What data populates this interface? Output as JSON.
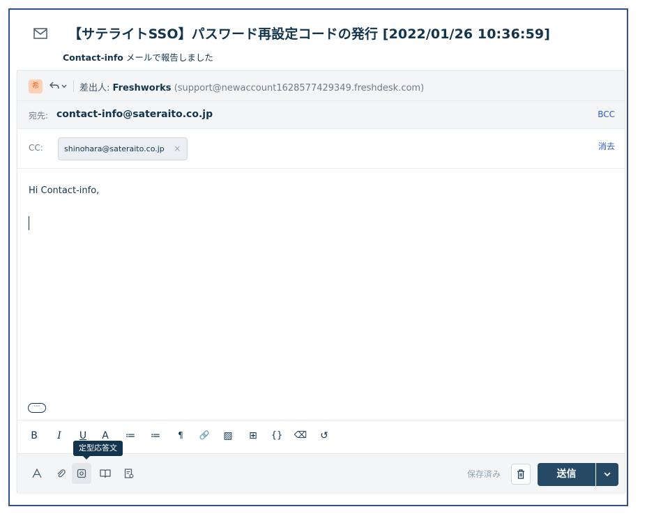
{
  "header": {
    "title": "【サテライトSSO】パスワード再設定コードの発行 [2022/01/26 10:36:59]",
    "subtitle_agent": "Contact-info",
    "subtitle_text": "メールで報告しました"
  },
  "from_row": {
    "avatar_text": "希",
    "label": "差出人:",
    "name": "Freshworks",
    "email": "(support@newaccount1628577429349.freshdesk.com)"
  },
  "to_row": {
    "label": "宛先:",
    "value": "contact-info@sateraito.co.jp",
    "bcc_label": "BCC"
  },
  "cc_row": {
    "label": "CC:",
    "chip": "shinohara@sateraito.co.jp",
    "chip_remove": "×",
    "clear_label": "消去"
  },
  "editor": {
    "greeting": "Hi Contact-info,",
    "more": "⋯"
  },
  "toolbar": {
    "bold": "B",
    "italic": "I",
    "underline": "U",
    "font_size": "A",
    "ordered_list": "≔",
    "bullet_list": "≔",
    "paragraph": "¶",
    "link": "🔗",
    "image": "▨",
    "table": "⊞",
    "code": "{}",
    "clear_format": "⌫",
    "history": "↺",
    "tooltip": "定型応答文"
  },
  "footer": {
    "saved_label": "保存済み",
    "send_label": "送信",
    "send_dropdown": "⌄"
  }
}
